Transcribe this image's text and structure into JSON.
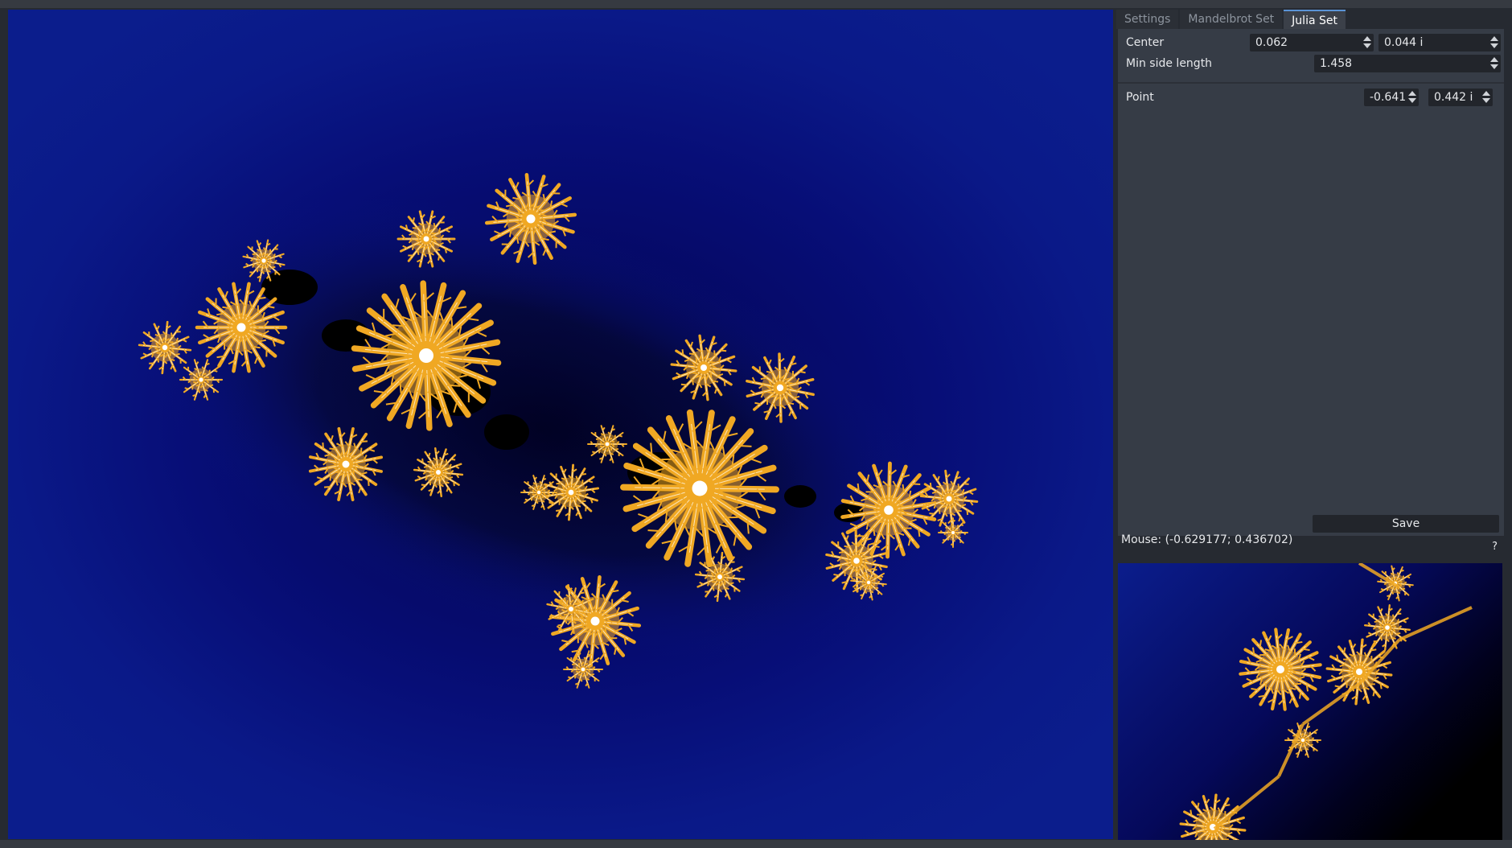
{
  "tabs": [
    {
      "label": "Settings",
      "active": false
    },
    {
      "label": "Mandelbrot Set",
      "active": false
    },
    {
      "label": "Julia Set",
      "active": true
    }
  ],
  "julia": {
    "center_label": "Center",
    "center_re": "0.062",
    "center_im": "0.044 i",
    "min_side_label": "Min side length",
    "min_side": "1.458",
    "point_label": "Point",
    "point_re": "-0.641",
    "point_im": "0.442 i",
    "save_label": "Save"
  },
  "status": {
    "mouse": "Mouse: (-0.629177; 0.436702)",
    "help": "?"
  },
  "icons": {
    "spin_arrows": "spinbox-arrows-icon"
  },
  "colors": {
    "fractal_background": "#0b1d8c",
    "fractal_gold": "#f0a823",
    "fractal_edge": "#ffffff",
    "panel_background": "#363c46",
    "tab_accent": "#5a93d6"
  }
}
